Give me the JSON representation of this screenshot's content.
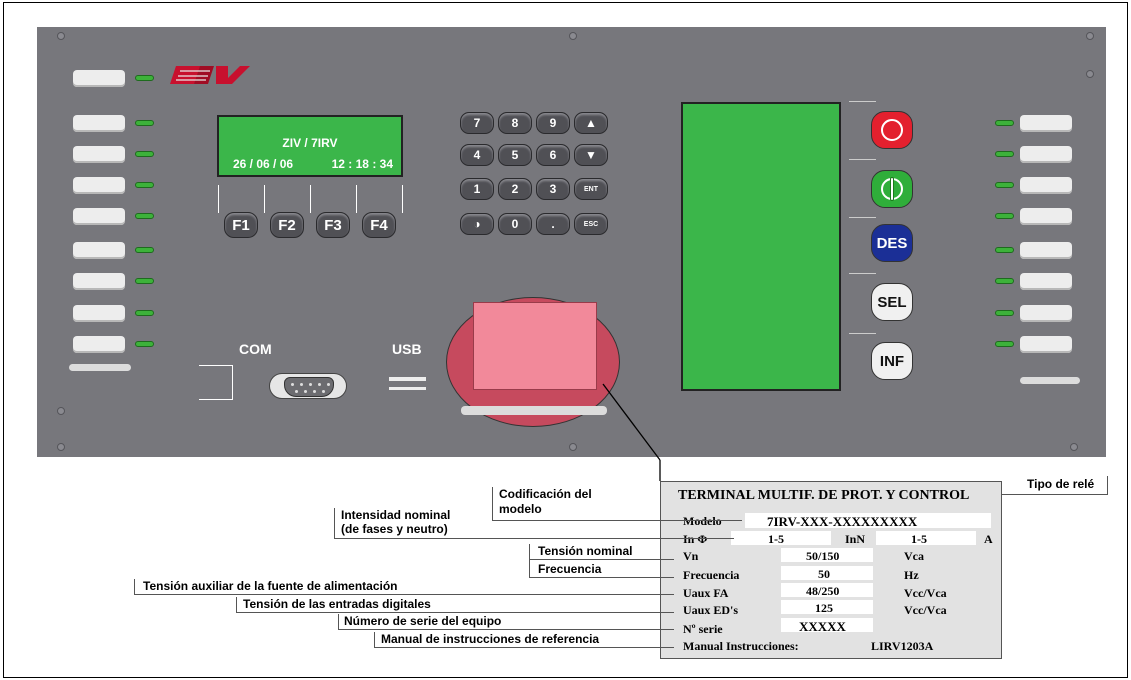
{
  "panel": {
    "display": {
      "line1": "ZIV / 7IRV",
      "date": "26 / 06 / 06",
      "time": "12 : 18 : 34"
    },
    "function_keys": [
      "F1",
      "F2",
      "F3",
      "F4"
    ],
    "keypad": [
      [
        "7",
        "8",
        "9",
        "▲"
      ],
      [
        "4",
        "5",
        "6",
        "▼"
      ],
      [
        "1",
        "2",
        "3",
        "ENT"
      ],
      [
        "◑",
        "0",
        ".",
        "ESC"
      ]
    ],
    "side_buttons": [
      "O",
      "I",
      "DES",
      "SEL",
      "INF"
    ],
    "com_label": "COM",
    "usb_label": "USB",
    "colors": {
      "panel": "#77777c",
      "display": "#3bb64a",
      "open": "#e3202e",
      "close": "#2fae3a",
      "des": "#1b2f96",
      "logo": "#c8102e"
    }
  },
  "plate": {
    "title": "TERMINAL MULTIF. DE PROT. Y CONTROL",
    "modelo_label": "Modelo",
    "modelo_value": "7IRV-XXX-XXXXXXXXX",
    "in_label": "In  Φ",
    "in_value": "1-5",
    "inn_label": "InN",
    "inn_value": "1-5",
    "in_unit": "A",
    "vn_label": "Vn",
    "vn_value": "50/150",
    "vn_unit": "Vca",
    "freq_label": "Frecuencia",
    "freq_value": "50",
    "freq_unit": "Hz",
    "uaux_label": "Uaux FA",
    "uaux_value": "48/250",
    "uaux_unit": "Vcc/Vca",
    "ued_label": "Uaux ED's",
    "ued_value": "125",
    "ued_unit": "Vcc/Vca",
    "serie_label": "Nº serie",
    "serie_value": "XXXXX",
    "manual_label": "Manual Instrucciones:",
    "manual_value": "LIRV1203A"
  },
  "callouts": {
    "tipo": "Tipo de relé",
    "codif1": "Codificación del",
    "codif2": "modelo",
    "intens1": "Intensidad nominal",
    "intens2": "(de fases y neutro)",
    "tension_nominal": "Tensión nominal",
    "frecuencia": "Frecuencia",
    "tension_aux": "Tensión auxiliar de la fuente de alimentación",
    "tension_ed": "Tensión de las entradas digitales",
    "serie": "Número de serie del equipo",
    "manual": "Manual de instrucciones de referencia"
  }
}
